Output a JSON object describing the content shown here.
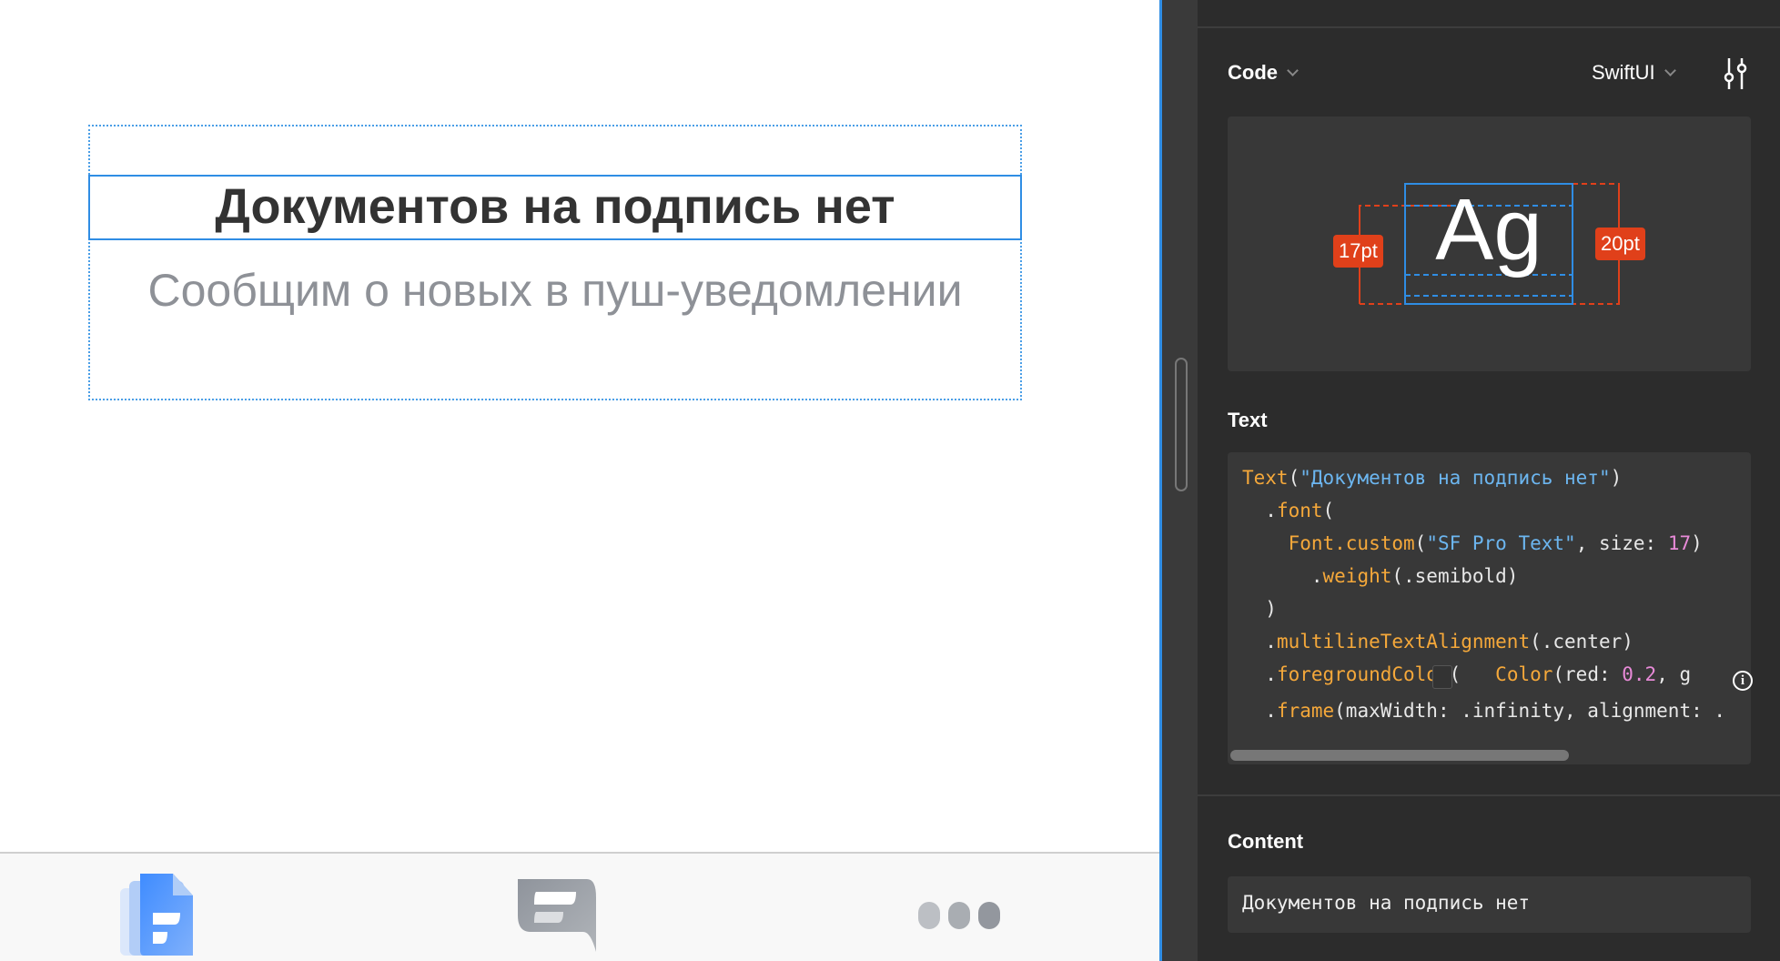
{
  "canvas": {
    "title": "Документов на подпись нет",
    "subtitle": "Сообщим о новых в пуш-уведомлении",
    "tabs": [
      {
        "icon": "documents-icon",
        "active": true
      },
      {
        "icon": "chat-icon",
        "active": false
      },
      {
        "icon": "more-icon",
        "active": false
      }
    ]
  },
  "inspector": {
    "code_label": "Code",
    "language": "SwiftUI",
    "typography": {
      "font_size_badge": "17pt",
      "line_height_badge": "20pt",
      "sample": "Ag"
    },
    "text_section_label": "Text",
    "code_lines": [
      [
        [
          "fn",
          "Text"
        ],
        [
          "",
          "("
        ],
        [
          "str",
          "\"Документов на подпись нет\""
        ],
        [
          "",
          ")"
        ]
      ],
      [
        [
          "",
          "  ."
        ],
        [
          "fn",
          "font"
        ],
        [
          "",
          "("
        ]
      ],
      [
        [
          "",
          "    "
        ],
        [
          "fn",
          "Font.custom"
        ],
        [
          "",
          "("
        ],
        [
          "str",
          "\"SF Pro Text\""
        ],
        [
          "",
          ", size: "
        ],
        [
          "num",
          "17"
        ],
        [
          "",
          ")"
        ]
      ],
      [
        [
          "",
          "      ."
        ],
        [
          "fn",
          "weight"
        ],
        [
          "",
          "(.semibold)"
        ]
      ],
      [
        [
          "",
          "  )"
        ]
      ],
      [
        [
          "",
          "  ."
        ],
        [
          "fn",
          "multilineTextAlignment"
        ],
        [
          "",
          "(.center)"
        ]
      ],
      [
        [
          "",
          "  ."
        ],
        [
          "fn",
          "foregroundColor"
        ],
        [
          "",
          "(   "
        ],
        [
          "fn",
          "Color"
        ],
        [
          "",
          "(red: "
        ],
        [
          "num",
          "0.2"
        ],
        [
          "",
          ", g"
        ]
      ],
      [
        [
          "",
          "  ."
        ],
        [
          "fn",
          "frame"
        ],
        [
          "",
          "(maxWidth: .infinity, alignment: ."
        ]
      ]
    ],
    "content_label": "Content",
    "content_value": "Документов на подпись нет",
    "colors": {
      "accent": "#2f8de4",
      "badge": "#e0401a",
      "swatch": "#333333"
    }
  }
}
